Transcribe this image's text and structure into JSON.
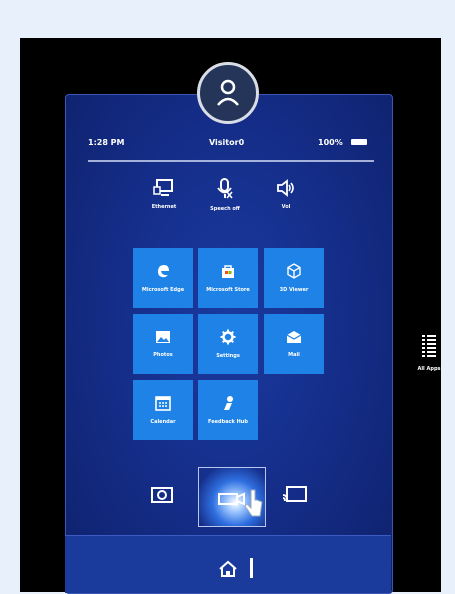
{
  "status_bar": {
    "time": "1:28 PM",
    "user": "Visitor0",
    "battery": "100%"
  },
  "quick_actions": [
    {
      "label": "Ethernet",
      "icon": "ethernet-icon"
    },
    {
      "label": "Speech off",
      "icon": "microphone-off-icon"
    },
    {
      "label": "Vol",
      "icon": "volume-icon"
    }
  ],
  "tiles": [
    {
      "label": "Microsoft Edge",
      "icon": "edge-icon"
    },
    {
      "label": "Microsoft Store",
      "icon": "store-icon"
    },
    {
      "label": "3D Viewer",
      "icon": "3d-viewer-icon"
    },
    {
      "label": "Photos",
      "icon": "photos-icon"
    },
    {
      "label": "Settings",
      "icon": "settings-gear-icon"
    },
    {
      "label": "Mail",
      "icon": "mail-icon"
    },
    {
      "label": "Calendar",
      "icon": "calendar-icon"
    },
    {
      "label": "Feedback Hub",
      "icon": "feedback-hub-icon"
    }
  ],
  "all_apps": {
    "label": "All Apps",
    "icon": "all-apps-list-icon"
  },
  "colors": {
    "tile": "#1f82e6",
    "panel": "#142c86",
    "background": "#e8f1fb",
    "frame": "#000000"
  }
}
